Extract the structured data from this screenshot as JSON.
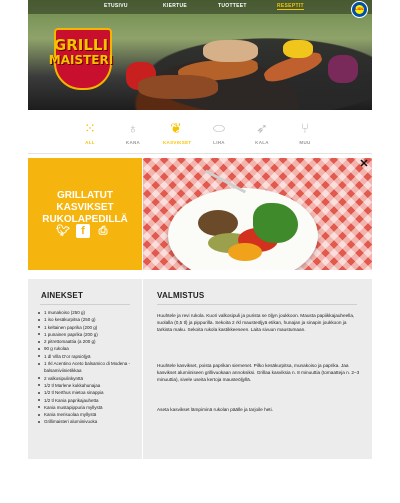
{
  "nav": {
    "items": [
      "ETUSIVU",
      "KIERTUE",
      "TUOTTEET",
      "RESEPTIT"
    ],
    "active_index": 3,
    "store_logo": "LIDL"
  },
  "brand": {
    "line1": "GRILLI",
    "line2": "MAISTERI"
  },
  "categories": [
    {
      "label": "ALL",
      "icon": "grid-dots-icon"
    },
    {
      "label": "KANA",
      "icon": "chicken-leg-icon"
    },
    {
      "label": "KASVIKSET",
      "icon": "corn-icon",
      "active": true
    },
    {
      "label": "LIHA",
      "icon": "steak-icon"
    },
    {
      "label": "KALA",
      "icon": "fish-icon"
    },
    {
      "label": "MUU",
      "icon": "cutlery-icon"
    }
  ],
  "recipe": {
    "title": "GRILLATUT KASVIKSET RUKOLAPEDILLÄ",
    "social": [
      "twitter-icon",
      "facebook-icon",
      "print-icon"
    ]
  },
  "ingredients": {
    "heading": "AINEKSET",
    "items": [
      "1 munakoiso (250 g)",
      "1 iso kesäkurpitsa (250 g)",
      "1 keltainen paprika (200 g)",
      "1 punainen paprika (200 g)",
      "2 pitrettomaattia (a 200 g)",
      "90 g rukolaa",
      "1 dl Villa D'or rapsiöljyä",
      "1 rkl Acentino Aceto balsamico di Modena -balsamiviinietikkaa",
      "2 valkosipulinkynttä",
      "1/2 tl Marlene kukkahunajaa",
      "1/2 tl Nerthus mietoa sinappia",
      "1/2 tl Kania paprikajauhetta",
      "Kania mustapippuria myllystä",
      "Kania merisuolaa myllystä",
      "Grillimaisteri alumiinivuoka"
    ]
  },
  "preparation": {
    "heading": "VALMISTUS",
    "paragraphs": [
      "Huuhtele ja revi rukola. Kuori valkosipuli ja purista se öljyn joukkoon. Mausta papiikkajauheella, suolalla (0,5 tl) ja pippurilla. Sekoita 2 rkl mausteöljyä etikan, hunajan ja sinapin joukkoon ja tarkista maku. Sekoita rukola kastikkeeseen. Laita sivuun maustumaan.",
      "Huuhtele kasvikset, poista paprikan siemenet. Pilko kesäkurpitsa, munakoiso ja paprika. Jaa kasvikset alumiiniseen grillivuokaan annoksiksi. Grillaa kasviksia n. 8 minuuttia (tomaatteja n. 2–3 minuuttia), sivele useita kertoja mausteöljyllä.",
      "Aseta kasvikset lämpiminä rukolan päälle ja tarjoile heti."
    ]
  },
  "colors": {
    "accent": "#f5b50e",
    "panel": "#ececec"
  }
}
